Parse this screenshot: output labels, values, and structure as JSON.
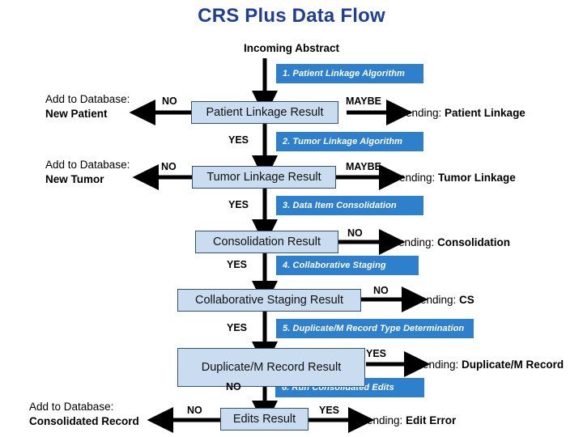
{
  "title": "CRS Plus Data Flow",
  "entry_label": "Incoming Abstract",
  "colors": {
    "title": "#1f3f95",
    "banner_bg": "#2e80cc",
    "banner_text": "#ffffff",
    "result_fill": "#c9dcf0",
    "result_border": "#31536e",
    "arrow": "#000000"
  },
  "steps": [
    {
      "id": "step-1",
      "label": "1. Patient Linkage Algorithm"
    },
    {
      "id": "step-2",
      "label": "2. Tumor Linkage Algorithm"
    },
    {
      "id": "step-3",
      "label": "3. Data Item Consolidation"
    },
    {
      "id": "step-4",
      "label": "4. Collaborative Staging"
    },
    {
      "id": "step-5",
      "label": "5. Duplicate/M Record Type Determination"
    },
    {
      "id": "step-6",
      "label": "6. Run Consolidated Edits"
    }
  ],
  "results": [
    {
      "id": "result-1",
      "label": "Patient Linkage Result"
    },
    {
      "id": "result-2",
      "label": "Tumor Linkage Result"
    },
    {
      "id": "result-3",
      "label": "Consolidation Result"
    },
    {
      "id": "result-4",
      "label": "Collaborative Staging Result"
    },
    {
      "id": "result-5",
      "label": "Duplicate/M Record Result"
    },
    {
      "id": "result-6",
      "label": "Edits Result"
    }
  ],
  "branches": {
    "no_1": "NO",
    "yes_1": "YES",
    "maybe_1": "MAYBE",
    "no_2": "NO",
    "yes_2": "YES",
    "maybe_2": "MAYBE",
    "yes_3": "YES",
    "no_3": "NO",
    "yes_4": "YES",
    "no_4": "NO",
    "yes_5": "YES",
    "no_5": "NO",
    "yes_6": "YES",
    "no_6": "NO"
  },
  "outcomes": {
    "add_patient_line1": "Add to Database:",
    "add_patient_line2": "New Patient",
    "add_tumor_line1": "Add to Database:",
    "add_tumor_line2": "New Tumor",
    "add_consolidated_line1": "Add to Database:",
    "add_consolidated_line2": "Consolidated Record",
    "pending_prefix": "Pending: ",
    "pending_patient_linkage": "Patient Linkage",
    "pending_tumor_linkage": "Tumor Linkage",
    "pending_consolidation": "Consolidation",
    "pending_cs": "CS",
    "pending_duplicate": "Duplicate/M Record",
    "pending_edit_error": "Edit Error"
  }
}
